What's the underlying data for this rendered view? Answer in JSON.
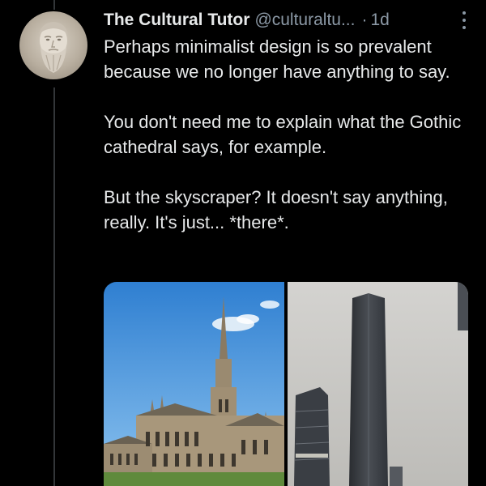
{
  "author": {
    "display_name": "The Cultural Tutor",
    "handle": "@culturaltu...",
    "separator": "·",
    "timestamp": "1d",
    "avatar_icon": "bust-portrait-avatar"
  },
  "tweet": {
    "paragraphs": [
      "Perhaps minimalist design is so prevalent because we no longer have anything to say.",
      "You don't need me to explain what the Gothic cathedral says, for example.",
      "But the skyscraper? It doesn't say anything, really. It's just... *there*."
    ]
  },
  "media": [
    {
      "subject": "gothic-cathedral"
    },
    {
      "subject": "skyscraper"
    }
  ],
  "colors": {
    "background": "#000000",
    "text_primary": "#e7e9ea",
    "text_secondary": "#8b98a5",
    "thread_line": "#333639"
  }
}
